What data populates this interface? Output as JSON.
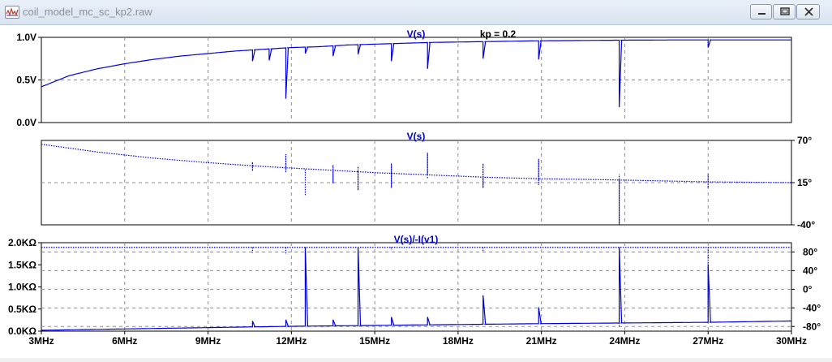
{
  "window": {
    "title": "coil_model_mc_sc_kp2.raw"
  },
  "chart_data": [
    {
      "type": "line",
      "title": "V(s)",
      "annotation": "kp = 0.2",
      "x_ticks": [
        "3MHz",
        "6MHz",
        "9MHz",
        "12MHz",
        "15MHz",
        "18MHz",
        "21MHz",
        "24MHz",
        "27MHz",
        "30MHz"
      ],
      "xlim_mhz": [
        3,
        30
      ],
      "ylim": [
        0,
        1
      ],
      "y_ticks": [
        {
          "v": 0,
          "label": "0.0V"
        },
        {
          "v": 0.5,
          "label": "0.5V"
        },
        {
          "v": 1.0,
          "label": "1.0V"
        }
      ],
      "baseline": [
        [
          3,
          0.42
        ],
        [
          4,
          0.55
        ],
        [
          5,
          0.63
        ],
        [
          6,
          0.69
        ],
        [
          7,
          0.74
        ],
        [
          8,
          0.78
        ],
        [
          9,
          0.81
        ],
        [
          10,
          0.84
        ],
        [
          11,
          0.86
        ],
        [
          12,
          0.88
        ],
        [
          13,
          0.89
        ],
        [
          14,
          0.91
        ],
        [
          15,
          0.92
        ],
        [
          16,
          0.93
        ],
        [
          17,
          0.94
        ],
        [
          18,
          0.945
        ],
        [
          19,
          0.95
        ],
        [
          20,
          0.955
        ],
        [
          21,
          0.96
        ],
        [
          22,
          0.962
        ],
        [
          23,
          0.965
        ],
        [
          24,
          0.967
        ],
        [
          25,
          0.968
        ],
        [
          26,
          0.97
        ],
        [
          27,
          0.97
        ],
        [
          28,
          0.97
        ],
        [
          29,
          0.97
        ],
        [
          30,
          0.97
        ]
      ],
      "spikes": [
        {
          "x": 10.6,
          "y": 0.72
        },
        {
          "x": 11.2,
          "y": 0.73
        },
        {
          "x": 11.8,
          "y": 0.28
        },
        {
          "x": 12.5,
          "y": 0.81
        },
        {
          "x": 13.5,
          "y": 0.78
        },
        {
          "x": 14.4,
          "y": 0.8
        },
        {
          "x": 15.6,
          "y": 0.72
        },
        {
          "x": 16.9,
          "y": 0.63
        },
        {
          "x": 18.9,
          "y": 0.75
        },
        {
          "x": 20.9,
          "y": 0.74
        },
        {
          "x": 23.8,
          "y": 0.18
        },
        {
          "x": 27.0,
          "y": 0.88
        }
      ]
    },
    {
      "type": "line",
      "title": "V(s)",
      "xlim_mhz": [
        3,
        30
      ],
      "ylim": [
        -40,
        70
      ],
      "y_ticks": [
        {
          "v": 70,
          "label": "70°"
        },
        {
          "v": 15,
          "label": "15°"
        },
        {
          "v": -40,
          "label": "-40°"
        }
      ],
      "baseline": [
        [
          3,
          65
        ],
        [
          5,
          55
        ],
        [
          7,
          47
        ],
        [
          9,
          41
        ],
        [
          11,
          36
        ],
        [
          13,
          32
        ],
        [
          15,
          28
        ],
        [
          17,
          25
        ],
        [
          19,
          22
        ],
        [
          21,
          20
        ],
        [
          23,
          19
        ],
        [
          25,
          17.5
        ],
        [
          27,
          16
        ],
        [
          30,
          15
        ]
      ],
      "spikes": [
        {
          "x": 10.6,
          "hi": 42,
          "lo": 30
        },
        {
          "x": 11.8,
          "hi": 52,
          "lo": 28
        },
        {
          "x": 12.5,
          "hi": 33,
          "lo": -2
        },
        {
          "x": 13.5,
          "hi": 38,
          "lo": 14
        },
        {
          "x": 14.4,
          "hi": 36,
          "lo": 5
        },
        {
          "x": 15.6,
          "hi": 40,
          "lo": 8
        },
        {
          "x": 16.9,
          "hi": 54,
          "lo": 20
        },
        {
          "x": 18.9,
          "hi": 40,
          "lo": 8
        },
        {
          "x": 20.9,
          "hi": 46,
          "lo": 12
        },
        {
          "x": 23.8,
          "hi": 26,
          "lo": -40
        },
        {
          "x": 27.0,
          "hi": 26,
          "lo": 8
        }
      ]
    },
    {
      "type": "line",
      "title": "V(s)/-I(v1)",
      "xlim_mhz": [
        3,
        30
      ],
      "ylim": [
        0,
        2000
      ],
      "y_ticks": [
        {
          "v": 0,
          "label": "0.0KΩ"
        },
        {
          "v": 500,
          "label": "0.5KΩ"
        },
        {
          "v": 1000,
          "label": "1.0KΩ"
        },
        {
          "v": 1500,
          "label": "1.5KΩ"
        },
        {
          "v": 2000,
          "label": "2.0KΩ"
        }
      ],
      "y2lim": [
        -90,
        100
      ],
      "y2_ticks": [
        {
          "v": 80,
          "label": "80°"
        },
        {
          "v": 40,
          "label": "40°"
        },
        {
          "v": 0,
          "label": "0°"
        },
        {
          "v": -40,
          "label": "-40°"
        },
        {
          "v": -80,
          "label": "-80°"
        }
      ],
      "baseline": [
        [
          3,
          20
        ],
        [
          6,
          50
        ],
        [
          9,
          80
        ],
        [
          12,
          110
        ],
        [
          15,
          130
        ],
        [
          18,
          150
        ],
        [
          21,
          170
        ],
        [
          24,
          185
        ],
        [
          27,
          200
        ],
        [
          30,
          230
        ]
      ],
      "spikes": [
        {
          "x": 10.6,
          "y": 230
        },
        {
          "x": 11.8,
          "y": 260
        },
        {
          "x": 12.5,
          "y": 1900
        },
        {
          "x": 13.5,
          "y": 260
        },
        {
          "x": 14.4,
          "y": 1900
        },
        {
          "x": 15.6,
          "y": 320
        },
        {
          "x": 16.9,
          "y": 320
        },
        {
          "x": 18.9,
          "y": 810
        },
        {
          "x": 20.9,
          "y": 540
        },
        {
          "x": 23.8,
          "y": 1900
        },
        {
          "x": 27.0,
          "y": 1500
        }
      ],
      "phase_level": 90,
      "phase_spikes": [
        {
          "x": 10.6,
          "lo": 78
        },
        {
          "x": 11.8,
          "lo": 74
        },
        {
          "x": 12.5,
          "lo": -80
        },
        {
          "x": 14.4,
          "lo": -80
        },
        {
          "x": 15.6,
          "lo": 84
        },
        {
          "x": 18.9,
          "lo": 80
        },
        {
          "x": 23.8,
          "lo": -80
        },
        {
          "x": 27.0,
          "lo": -60
        }
      ]
    }
  ],
  "colors": {
    "trace": "#0000dd",
    "grid": "#909090",
    "axis": "#000000",
    "title": "#0000cc"
  }
}
